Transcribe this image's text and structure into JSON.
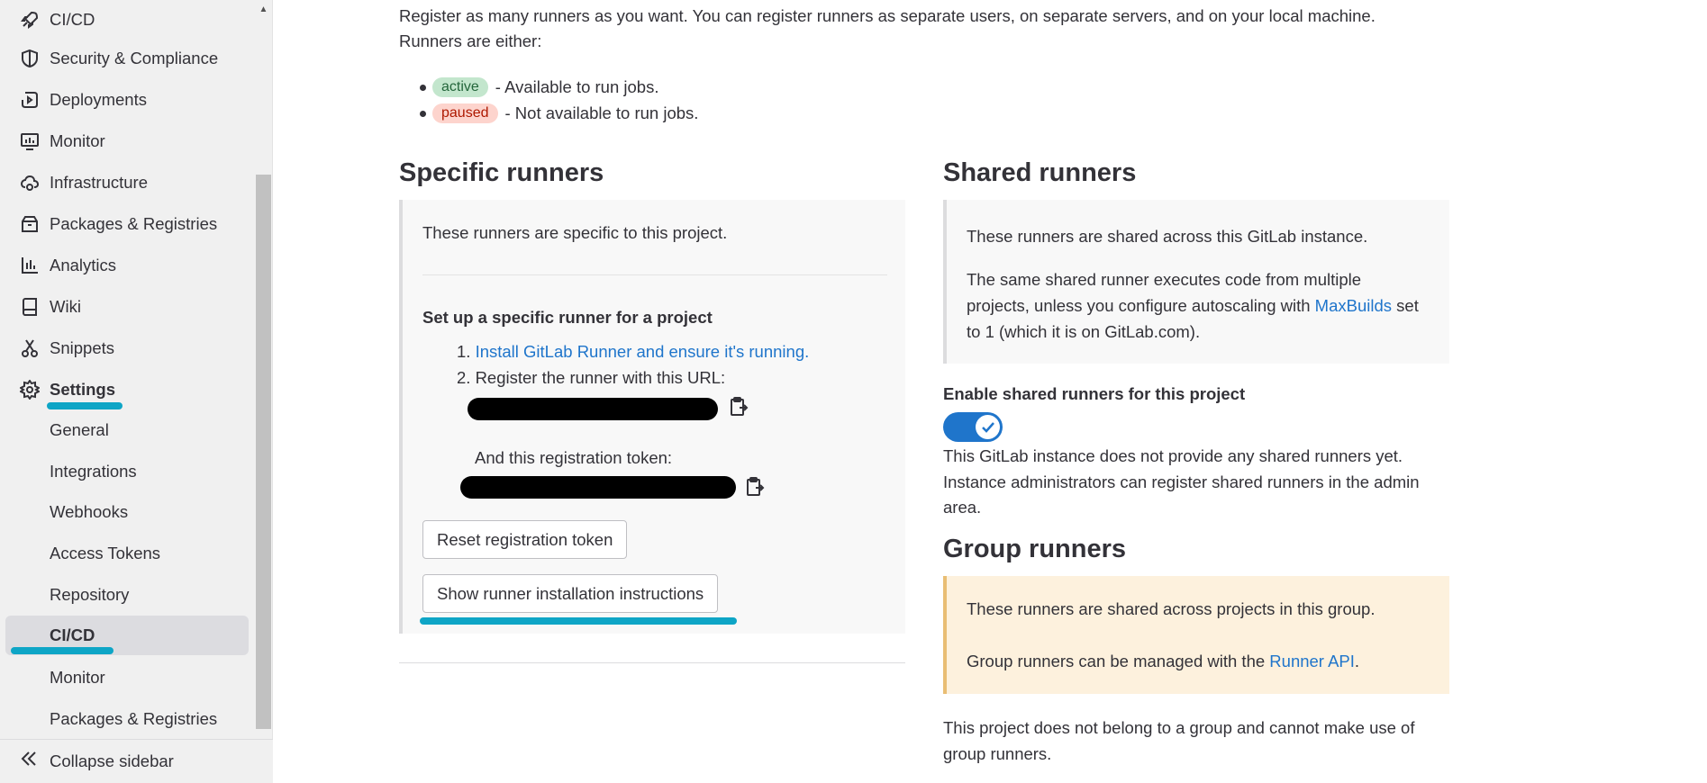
{
  "sidebar": {
    "items": [
      {
        "label": "CI/CD",
        "icon": "rocket-icon"
      },
      {
        "label": "Security & Compliance",
        "icon": "shield-icon"
      },
      {
        "label": "Deployments",
        "icon": "deployments-icon"
      },
      {
        "label": "Monitor",
        "icon": "monitor-icon"
      },
      {
        "label": "Infrastructure",
        "icon": "cloud-gear-icon"
      },
      {
        "label": "Packages & Registries",
        "icon": "package-icon"
      },
      {
        "label": "Analytics",
        "icon": "chart-icon"
      },
      {
        "label": "Wiki",
        "icon": "book-icon"
      },
      {
        "label": "Snippets",
        "icon": "scissors-icon"
      },
      {
        "label": "Settings",
        "icon": "gear-icon"
      }
    ],
    "settings_sub": [
      {
        "label": "General"
      },
      {
        "label": "Integrations"
      },
      {
        "label": "Webhooks"
      },
      {
        "label": "Access Tokens"
      },
      {
        "label": "Repository"
      },
      {
        "label": "CI/CD"
      },
      {
        "label": "Monitor"
      },
      {
        "label": "Packages & Registries"
      }
    ],
    "collapse_label": "Collapse sidebar"
  },
  "intro": {
    "line1": "Register as many runners as you want. You can register runners as separate users, on separate servers, and on your local machine.",
    "line2": "Runners are either:",
    "statuses": [
      {
        "badge": "active",
        "text": "- Available to run jobs."
      },
      {
        "badge": "paused",
        "text": "- Not available to run jobs."
      }
    ]
  },
  "specific": {
    "title": "Specific runners",
    "desc": "These runners are specific to this project.",
    "setup_title": "Set up a specific runner for a project",
    "step1_num": "1.",
    "step1_link": "Install GitLab Runner and ensure it's running.",
    "step2": "2. Register the runner with this URL:",
    "token_label": "And this registration token:",
    "reset_button": "Reset registration token",
    "show_button": "Show runner installation instructions"
  },
  "shared": {
    "title": "Shared runners",
    "p1": "These runners are shared across this GitLab instance.",
    "p2_a": "The same shared runner executes code from multiple projects, unless you configure autoscaling with ",
    "p2_link": "MaxBuilds",
    "p2_b": " set to 1 (which it is on GitLab.com).",
    "toggle_label": "Enable shared runners for this project",
    "toggle_on": true,
    "note": "This GitLab instance does not provide any shared runners yet. Instance administrators can register shared runners in the admin area."
  },
  "group": {
    "title": "Group runners",
    "p1": "These runners are shared across projects in this group.",
    "p2_a": "Group runners can be managed with the ",
    "p2_link": "Runner API",
    "p2_b": ".",
    "note": "This project does not belong to a group and cannot make use of group runners."
  },
  "colors": {
    "link": "#1f75cb",
    "highlight": "#0ea5c6",
    "toggle": "#1f75cb",
    "group_box": "#fdf1dd"
  }
}
